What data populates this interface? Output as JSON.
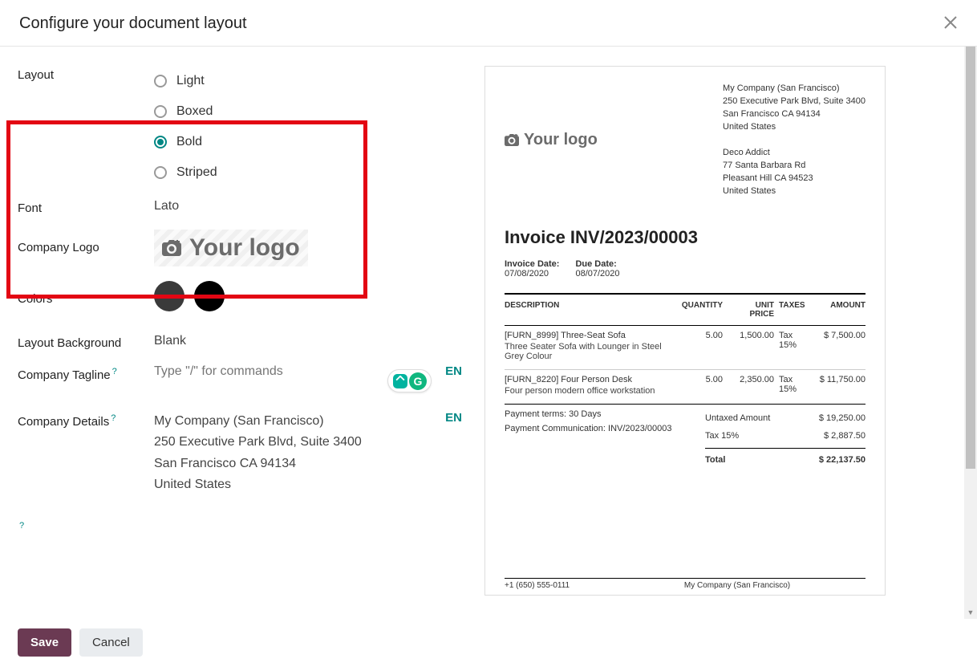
{
  "dialog": {
    "title": "Configure your document layout",
    "save_label": "Save",
    "cancel_label": "Cancel"
  },
  "form": {
    "layout_label": "Layout",
    "layout_options": {
      "light": "Light",
      "boxed": "Boxed",
      "bold": "Bold",
      "striped": "Striped"
    },
    "layout_selected": "Bold",
    "font_label": "Font",
    "font_value": "Lato",
    "company_logo_label": "Company Logo",
    "logo_placeholder": "Your logo",
    "colors_label": "Colors",
    "colors": {
      "primary": "#3a3a3a",
      "secondary": "#000000"
    },
    "layout_bg_label": "Layout Background",
    "layout_bg_value": "Blank",
    "tagline_label": "Company Tagline",
    "tagline_placeholder": "Type \"/\" for commands",
    "details_label": "Company Details",
    "lang_badge": "EN",
    "details": {
      "line1": "My Company (San Francisco)",
      "line2": "250 Executive Park Blvd, Suite 3400",
      "line3": "San Francisco CA 94134",
      "line4": "United States"
    }
  },
  "preview": {
    "logo_text": "Your logo",
    "company": {
      "name": "My Company (San Francisco)",
      "line1": "250 Executive Park Blvd, Suite 3400",
      "line2": "San Francisco CA 94134",
      "line3": "United States"
    },
    "customer": {
      "name": "Deco Addict",
      "line1": "77 Santa Barbara Rd",
      "line2": "Pleasant Hill CA 94523",
      "line3": "United States"
    },
    "invoice_title": "Invoice INV/2023/00003",
    "invoice_date_label": "Invoice Date:",
    "invoice_date": "07/08/2020",
    "due_date_label": "Due Date:",
    "due_date": "08/07/2020",
    "columns": {
      "description": "DESCRIPTION",
      "quantity": "QUANTITY",
      "unit_price_l1": "UNIT",
      "unit_price_l2": "PRICE",
      "taxes": "TAXES",
      "amount": "AMOUNT"
    },
    "lines": [
      {
        "code": "[FURN_8999] Three-Seat Sofa",
        "sub": "Three Seater Sofa with Lounger in Steel Grey Colour",
        "qty": "5.00",
        "price": "1,500.00",
        "tax": "Tax 15%",
        "amount": "$ 7,500.00"
      },
      {
        "code": "[FURN_8220] Four Person Desk",
        "sub": "Four person modern office workstation",
        "qty": "5.00",
        "price": "2,350.00",
        "tax": "Tax 15%",
        "amount": "$ 11,750.00"
      }
    ],
    "payment_terms_label": "Payment terms:",
    "payment_terms": "30 Days",
    "payment_comm_label": "Payment Communication:",
    "payment_comm": "INV/2023/00003",
    "totals": {
      "untaxed_label": "Untaxed Amount",
      "untaxed": "$ 19,250.00",
      "tax_label": "Tax 15%",
      "tax": "$ 2,887.50",
      "total_label": "Total",
      "total": "$ 22,137.50"
    },
    "footer_phone": "+1 (650) 555-0111",
    "footer_company": "My Company (San Francisco)"
  }
}
